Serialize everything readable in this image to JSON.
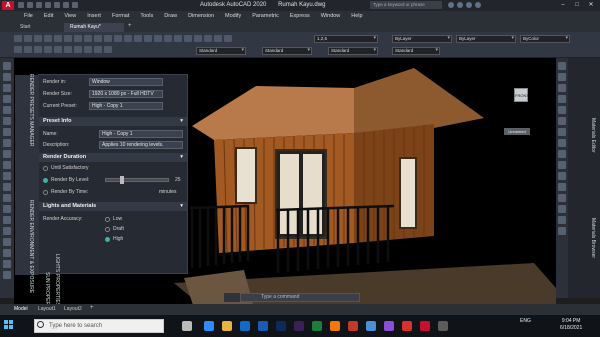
{
  "titlebar": {
    "app_name": "Autodesk AutoCAD 2020",
    "file_name": "Rumah Kayu.dwg",
    "search_placeholder": "Type a keyword or phrase"
  },
  "menu": [
    "File",
    "Edit",
    "View",
    "Insert",
    "Format",
    "Tools",
    "Draw",
    "Dimension",
    "Modify",
    "Parametric",
    "Express",
    "Window",
    "Help"
  ],
  "tabs": {
    "start": "Start",
    "document": "Rumah Kayu*",
    "add": "+"
  },
  "ribbon": {
    "style_dropdowns": [
      "Standard",
      "Standard",
      "Standard",
      "Standard"
    ],
    "layer_value": "1,2,5",
    "linetype": "ByLayer",
    "lineweight": "ByLayer",
    "color": "ByColor"
  },
  "render_panel": {
    "render_in_label": "Render in:",
    "render_in_value": "Window",
    "render_size_label": "Render Size:",
    "render_size_value": "1920 x 1080 px - Full HDTV",
    "current_preset_label": "Current Preset:",
    "current_preset_value": "High - Copy 1",
    "preset_info_header": "Preset Info",
    "name_label": "Name:",
    "name_value": "High - Copy 1",
    "description_label": "Description:",
    "description_value": "Applies 10 rendering levels.",
    "render_duration_header": "Render Duration",
    "until_satisfactory": "Until Satisfactory",
    "render_by_level": "Render By Level:",
    "level_value": "25",
    "level_fraction": 0.25,
    "render_by_time": "Render By Time:",
    "time_unit": "minutes",
    "lights_header": "Lights and Materials",
    "render_accuracy_label": "Render Accuracy:",
    "accuracy_options": [
      "Low",
      "Draft",
      "High"
    ],
    "accuracy_selected": "High"
  },
  "side_labels": {
    "render_environment": "RENDER ENVIRONMENT & EXPOSURE",
    "render_presets": "RENDER PRESETS MANAGER",
    "sun_properties": "SUN PROPERTIES",
    "lights": "LIGHTS",
    "properties": "PROPERTIES",
    "materials_editor": "Materials Editor",
    "materials_browser": "Materials Browser"
  },
  "viewport": {
    "view_label": "Unnamed",
    "viewcube_face": "FRONT"
  },
  "command_line": {
    "placeholder": "Type a command"
  },
  "layout_tabs": [
    "Model",
    "Layout1",
    "Layout2",
    "+"
  ],
  "taskbar": {
    "search_placeholder": "Type here to search",
    "language": "ENG",
    "time": "9:04 PM",
    "date": "6/18/2021"
  },
  "colors": {
    "accent": "#3db3a6",
    "autocad_red": "#c8102e",
    "wood": "#8a4a1c"
  }
}
